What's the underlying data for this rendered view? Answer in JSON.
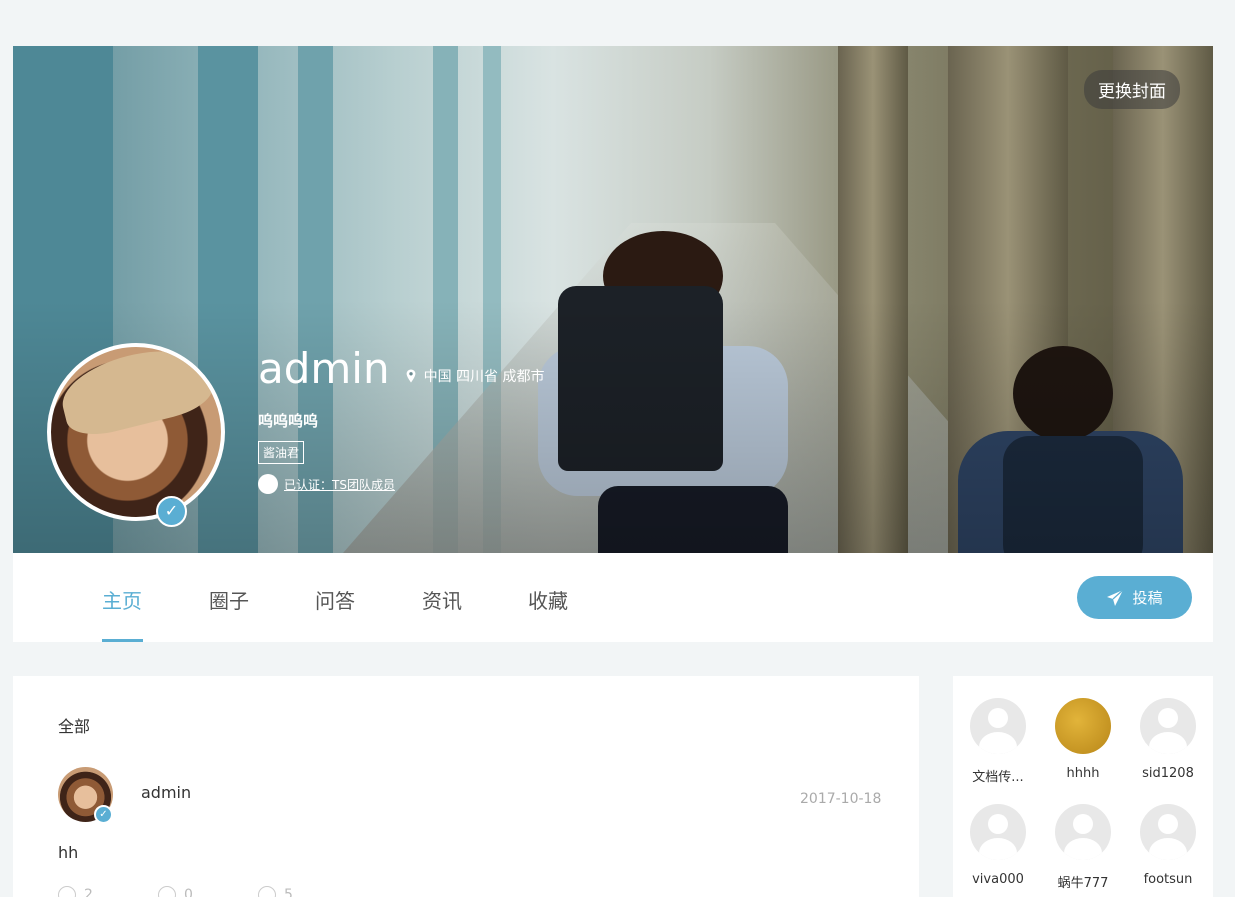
{
  "cover": {
    "change_cover_label": "更换封面"
  },
  "profile": {
    "name": "admin",
    "location": "中国 四川省 成都市",
    "signature": "呜呜呜呜",
    "tag": "酱油君",
    "certified_text": "已认证：TS团队成员"
  },
  "tabs": [
    {
      "label": "主页",
      "active": true
    },
    {
      "label": "圈子",
      "active": false
    },
    {
      "label": "问答",
      "active": false
    },
    {
      "label": "资讯",
      "active": false
    },
    {
      "label": "收藏",
      "active": false
    }
  ],
  "submit_button": {
    "label": "投稿"
  },
  "feed": {
    "filter_label": "全部",
    "post": {
      "author": "admin",
      "date": "2017-10-18",
      "content": "hh",
      "like_count": "2",
      "comment_count": "0",
      "view_count": "5"
    }
  },
  "friends": [
    {
      "name": "文档传...",
      "avatar": "default-avatar-icon"
    },
    {
      "name": "hhhh",
      "avatar": "gold-texture"
    },
    {
      "name": "sid1208",
      "avatar": "default-avatar-icon"
    },
    {
      "name": "viva000",
      "avatar": "default-avatar-icon"
    },
    {
      "name": "蜗牛777",
      "avatar": "default-avatar-icon"
    },
    {
      "name": "footsun",
      "avatar": "default-avatar-icon"
    }
  ],
  "colors": {
    "accent": "#5aaed3",
    "background": "#f2f5f6"
  }
}
